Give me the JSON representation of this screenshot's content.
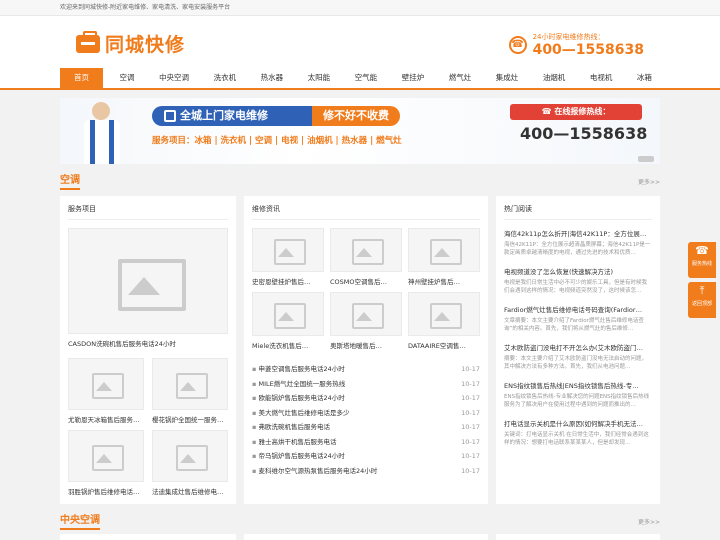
{
  "topbar": {
    "text": "欢迎来到同城快修-附近家电维修、家电清洗、家电安装服务平台"
  },
  "header": {
    "logo_text": "同城快修",
    "hotline_label": "24小时家电维修热线：",
    "hotline_number": "400—1558638"
  },
  "nav": [
    "首页",
    "空调",
    "中央空调",
    "洗衣机",
    "热水器",
    "太阳能",
    "空气能",
    "壁挂炉",
    "燃气灶",
    "集成灶",
    "油烟机",
    "电视机",
    "冰箱"
  ],
  "banner": {
    "title": "全城上门家电维修",
    "title2": "修不好不收费",
    "services": "服务项目：冰箱 | 洗衣机 | 空调 | 电视 | 油烟机 | 热水器 | 燃气灶",
    "tel_label": "☎ 在线报修热线：",
    "tel_number": "400—1558638"
  },
  "section1": {
    "title": "空调",
    "more": "更多>>"
  },
  "col1": {
    "title": "服务项目",
    "featured": "CASDON洗碗机售后服务电话24小时",
    "items": [
      "尤勒恩天冰箱售后服务…",
      "樱花锅炉全国统一服务…",
      "羽胜锅炉售后维修电话…",
      "法迪集成灶售后维修电…"
    ]
  },
  "col2": {
    "title": "维修资讯",
    "grid": [
      "史密恩壁挂炉售后…",
      "COSMO空调售后…",
      "神州壁挂炉售后…",
      "Miele洗衣机售后…",
      "奥斯塔地暖售后…",
      "DATAAIRE空调售…"
    ],
    "news": [
      {
        "title": "申菱空调售后服务电话24小时",
        "date": "10-17"
      },
      {
        "title": "MILE燃气灶全国统一服务热线",
        "date": "10-17"
      },
      {
        "title": "欧能锅炉售后服务电话24小时",
        "date": "10-17"
      },
      {
        "title": "美大燃气灶售后维修电话是多少",
        "date": "10-17"
      },
      {
        "title": "弗欧洗碗机售后服务电话",
        "date": "10-17"
      },
      {
        "title": "雅士高烘干机售后服务电话",
        "date": "10-17"
      },
      {
        "title": "帝马锅炉售后服务电话24小时",
        "date": "10-17"
      },
      {
        "title": "麦科维尔空气源热泵售后服务电话24小时",
        "date": "10-17"
      }
    ]
  },
  "col3": {
    "title": "热门阅读",
    "items": [
      {
        "title": "海信42k11p怎么折开|海信42K11P：全方位展…",
        "desc": "海信42K11P：全方位展示超清晶质屏幕；海信42K11P是一款定画质卓越清晰度的电视，通过先进的技术和优质…"
      },
      {
        "title": "电视频道没了怎么恢复(快速解决方法)",
        "desc": "电视是我们日常生活中必不可少的娱乐工具，但是有时候我们会遇到这样的情况：电视频道突然没了，这时候该怎…"
      },
      {
        "title": "Fardior燃气灶售后维修电话号码查询(Fardior…",
        "desc": "文章摘要：本文主要介绍了Fardior燃气灶售后维修电话查询”的相关内容。首先，我们将从燃气灶的售后维修…"
      },
      {
        "title": "艾木欧防盗门没电打不开怎么办(艾木欧防盗门…",
        "desc": "摘要：本文主要介绍了艾木欧防盗门没电无法启动的问题，其中解决方法有多种方法。首先，我们从电池问题…"
      },
      {
        "title": "ENS指纹锁售后热线|ENS指纹锁售后热线-专…",
        "desc": "ENS指纹锁售后热线-专业解决您的问题ENS指纹锁售后热线服务为了解决用户在使用过程中遇到的问题而推出的…"
      },
      {
        "title": "打电话显示关机是什么原因(如何解决手机无法…",
        "desc": "关键词：打电话显示关机 在日常生活中，我们经常会遇到这样的情况：想要打电话联系某某某人，但是却发现…"
      }
    ]
  },
  "float": [
    {
      "icon": "phone-icon",
      "label": "服务热线"
    },
    {
      "icon": "top-icon",
      "label": "返回顶部"
    }
  ],
  "section2": {
    "title": "中央空调",
    "more": "更多>>"
  },
  "colors": {
    "accent": "#f07c1c",
    "blue": "#2f62b6",
    "red": "#e24235"
  }
}
